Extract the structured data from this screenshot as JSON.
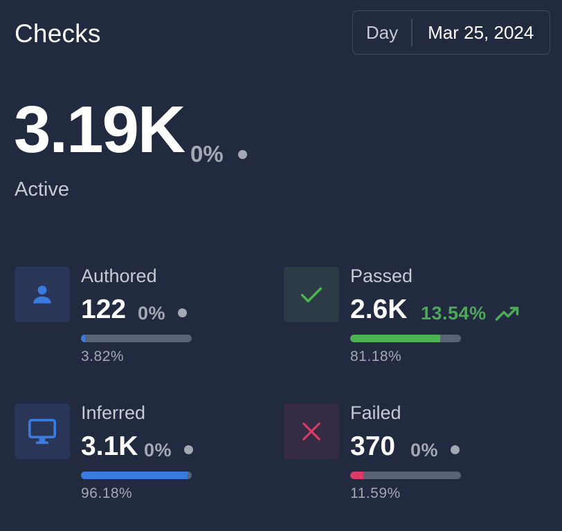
{
  "header": {
    "title": "Checks",
    "period": "Day",
    "date": "Mar 25, 2024"
  },
  "summary": {
    "value": "3.19K",
    "change": "0%",
    "label": "Active"
  },
  "cards": [
    {
      "label": "Authored",
      "value": "122",
      "change": "0%",
      "percent_text": "3.82%",
      "share": 0.0382,
      "color": "#3a7be0",
      "icon": "user-icon",
      "trend": "flat"
    },
    {
      "label": "Passed",
      "value": "2.6K",
      "change": "13.54%",
      "percent_text": "81.18%",
      "share": 0.8118,
      "color": "#4cb354",
      "icon": "check-icon",
      "trend": "up"
    },
    {
      "label": "Inferred",
      "value": "3.1K",
      "change": "0%",
      "percent_text": "96.18%",
      "share": 0.9618,
      "color": "#3a7be0",
      "icon": "monitor-icon",
      "trend": "flat"
    },
    {
      "label": "Failed",
      "value": "370",
      "change": "0%",
      "percent_text": "11.59%",
      "share": 0.1159,
      "color": "#dc3b63",
      "icon": "close-icon",
      "trend": "flat"
    }
  ]
}
